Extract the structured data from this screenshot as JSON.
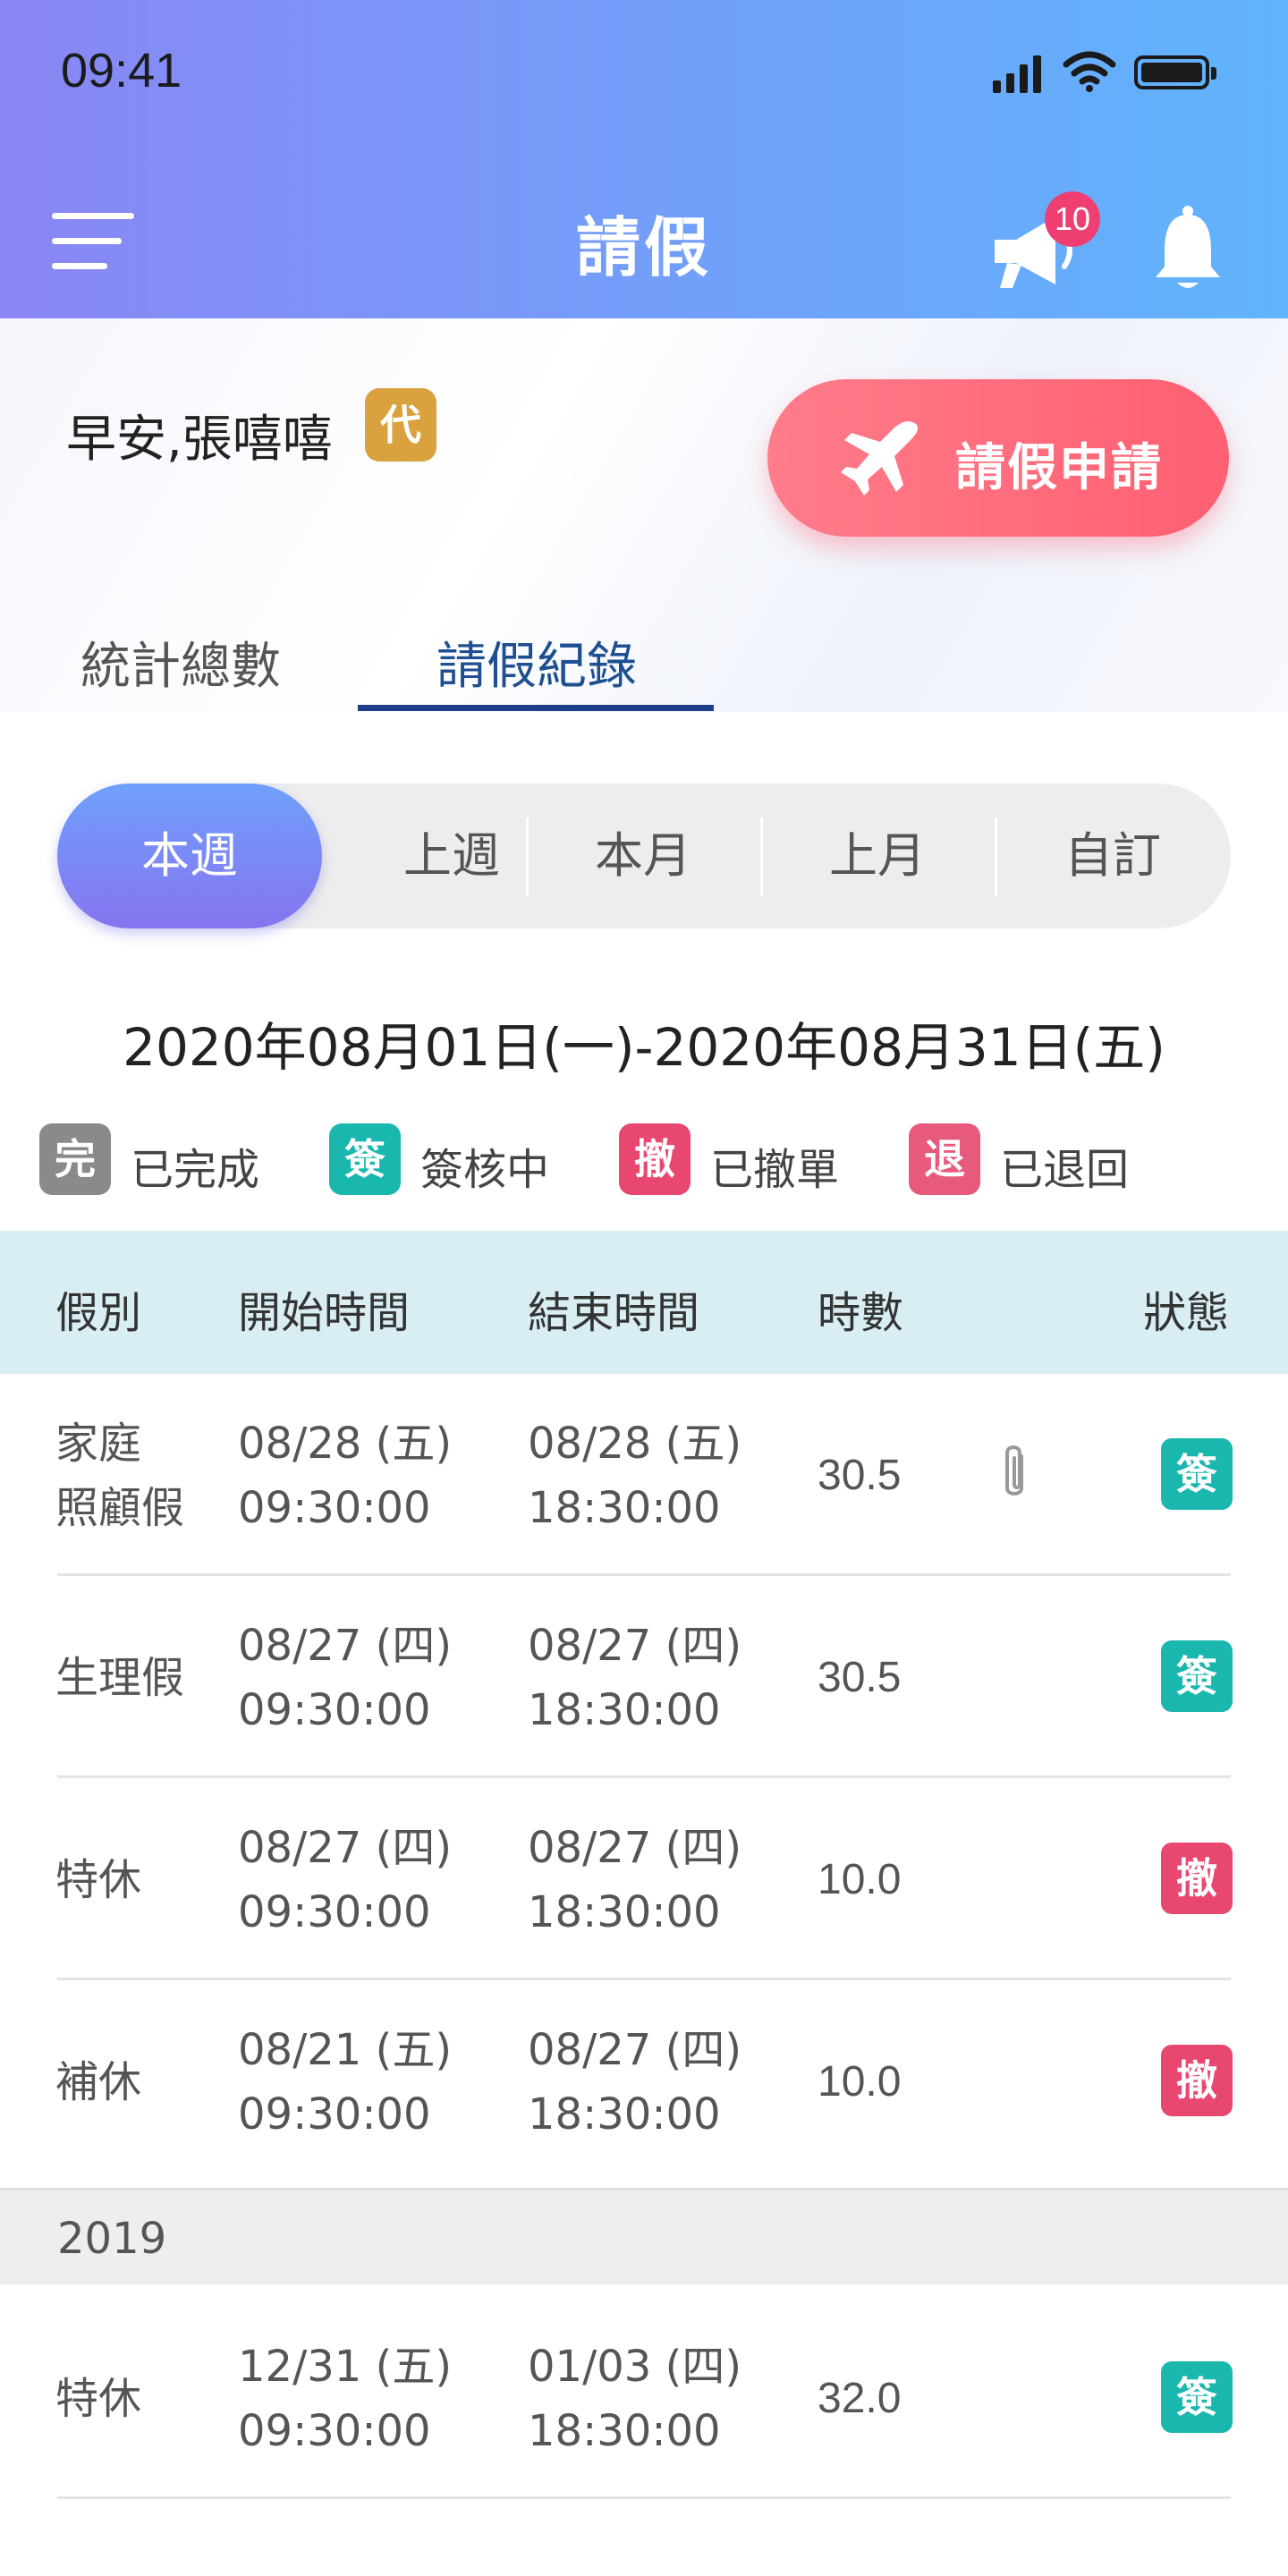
{
  "status_bar": {
    "time": "09:41"
  },
  "header": {
    "title": "請假",
    "notification_count": "10"
  },
  "greeting": {
    "text": "早安,張嘻嘻",
    "proxy_badge": "代"
  },
  "apply_button": {
    "label": "請假申請"
  },
  "tabs": [
    {
      "label": "統計總數",
      "active": false
    },
    {
      "label": "請假紀錄",
      "active": true
    }
  ],
  "period_filter": {
    "selected": "本週",
    "options": [
      "本週",
      "上週",
      "本月",
      "上月",
      "自訂"
    ]
  },
  "date_range": "2020年08月01日(一)-2020年08月31日(五)",
  "legend": [
    {
      "badge": "完",
      "label": "已完成",
      "color": "#8a8a8a"
    },
    {
      "badge": "簽",
      "label": "簽核中",
      "color": "#19b7ae"
    },
    {
      "badge": "撤",
      "label": "已撤單",
      "color": "#e8486f"
    },
    {
      "badge": "退",
      "label": "已退回",
      "color": "#e85a7c"
    }
  ],
  "table": {
    "headers": {
      "type": "假別",
      "start": "開始時間",
      "end": "結束時間",
      "hours": "時數",
      "status": "狀態"
    },
    "rows": [
      {
        "type_line1": "家庭",
        "type_line2": "照顧假",
        "start_date": "08/28 (五)",
        "start_time": "09:30:00",
        "end_date": "08/28 (五)",
        "end_time": "18:30:00",
        "hours": "30.5",
        "attachment": true,
        "status": "簽"
      },
      {
        "type_line1": "生理假",
        "type_line2": "",
        "start_date": "08/27 (四)",
        "start_time": "09:30:00",
        "end_date": "08/27 (四)",
        "end_time": "18:30:00",
        "hours": "30.5",
        "attachment": false,
        "status": "簽"
      },
      {
        "type_line1": "特休",
        "type_line2": "",
        "start_date": "08/27 (四)",
        "start_time": "09:30:00",
        "end_date": "08/27 (四)",
        "end_time": "18:30:00",
        "hours": "10.0",
        "attachment": false,
        "status": "撤"
      },
      {
        "type_line1": "補休",
        "type_line2": "",
        "start_date": "08/21 (五)",
        "start_time": "09:30:00",
        "end_date": "08/27 (四)",
        "end_time": "18:30:00",
        "hours": "10.0",
        "attachment": false,
        "status": "撤"
      }
    ],
    "year_group": "2019",
    "year_rows": [
      {
        "type_line1": "特休",
        "type_line2": "",
        "start_date": "12/31 (五)",
        "start_time": "09:30:00",
        "end_date": "01/03 (四)",
        "end_time": "18:30:00",
        "hours": "32.0",
        "attachment": false,
        "status": "簽"
      }
    ]
  },
  "colors": {
    "header_start": "#8a86f4",
    "header_end": "#60b4fb",
    "apply_button": "#ff5f72",
    "active_tab": "#1d4f91",
    "status_signing": "#19b7ae",
    "status_cancelled": "#e8486f"
  },
  "icons": [
    "menu-icon",
    "megaphone-icon",
    "bell-icon",
    "airplane-icon",
    "paperclip-icon",
    "signal-icon",
    "wifi-icon",
    "battery-icon"
  ]
}
